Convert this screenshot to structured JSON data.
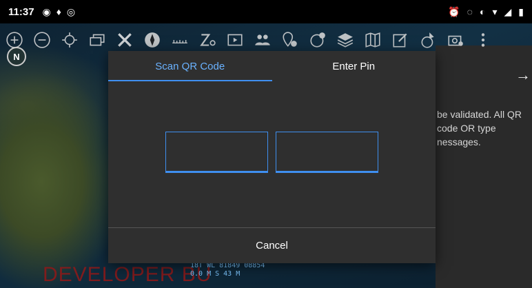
{
  "status_bar": {
    "time": "11:37",
    "left_icons": [
      "notification-icon",
      "alarm-bell-icon",
      "sync-icon"
    ],
    "right_icons": [
      "alarm-clock-icon",
      "location-icon",
      "data-saver-icon",
      "wifi-icon",
      "signal-icon",
      "battery-icon"
    ]
  },
  "toolbar": {
    "icons": [
      "zoom-in-icon",
      "zoom-out-icon",
      "gps-lock-icon",
      "layers-toggle-icon",
      "close-x-icon",
      "compass-rose-icon",
      "ruler-icon",
      "zoom-marker-icon",
      "video-icon",
      "group-icon",
      "add-point-icon",
      "add-overlay-icon",
      "layers-icon",
      "map-icon",
      "edit-icon",
      "pointer-icon",
      "camera-icon",
      "more-icon"
    ]
  },
  "map": {
    "compass_label": "N",
    "watermark": "DEVELOPER BU",
    "coords_line1": "18T WL 81849 08854",
    "coords_line2": "0.0 M S        43 M",
    "side_text": "be validated. All QR code OR type nessages."
  },
  "dialog": {
    "tabs": [
      {
        "label": "Scan QR Code",
        "active": true
      },
      {
        "label": "Enter Pin",
        "active": false
      }
    ],
    "cancel_label": "Cancel"
  },
  "colors": {
    "accent": "#3f8ff0",
    "active_tab_text": "#6ab2ff",
    "dialog_bg": "#2f2f2f",
    "watermark": "#8b1a1a"
  }
}
